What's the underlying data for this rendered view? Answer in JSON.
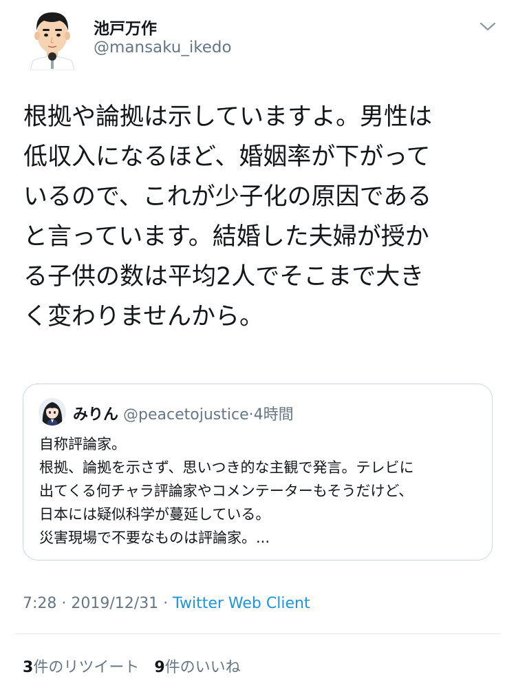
{
  "tweet": {
    "author": {
      "name": "池戸万作",
      "handle": "@mansaku_ikedo"
    },
    "menu_icon": "chevron-down-icon",
    "text": "根拠や論拠は示していますよ。男性は\n低収入になるほど、婚姻率が下がって\nいるので、これが少子化の原因である\nと言っています。結婚した夫婦が授か\nる子供の数は平均2人でそこまで大き\nく変わりませんから。",
    "quoted": {
      "name": "みりん",
      "handle": "@peacetojustice",
      "separator": "·",
      "time": "4時間",
      "text": "自称評論家。\n根拠、論拠を示さず、思いつき的な主観で発言。テレビに\n出てくる何チャラ評論家やコメンテーターもそうだけど、\n日本には疑似科学が蔓延している。\n災害現場で不要なものは評論家。..."
    },
    "timestamp": "7:28 · 2019/12/31 ·",
    "client": "Twitter Web Client",
    "stats": {
      "retweets_count": "3",
      "retweets_label": "件のリツイート",
      "likes_count": "9",
      "likes_label": "件のいいね"
    }
  },
  "colors": {
    "text": "#14171a",
    "secondary": "#657786",
    "link": "#1b95e0",
    "border": "#ccd6dd"
  }
}
